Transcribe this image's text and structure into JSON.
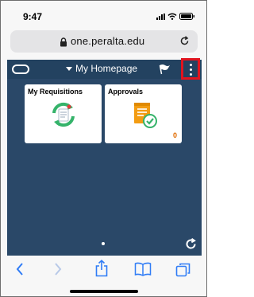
{
  "status_bar": {
    "time": "9:47",
    "icons": [
      "signal-icon",
      "wifi-icon",
      "battery-icon"
    ]
  },
  "browser": {
    "url": "one.peralta.edu",
    "icons": [
      "lock-icon",
      "reload-icon"
    ]
  },
  "app_header": {
    "title": "My Homepage",
    "icons": [
      "home-oval-icon",
      "caret-down-icon",
      "flag-icon",
      "actions-menu-icon"
    ],
    "highlight_color": "#e0141e"
  },
  "tiles": [
    {
      "title": "My Requisitions",
      "icon": "requisition-cycle-icon"
    },
    {
      "title": "Approvals",
      "icon": "approval-document-icon",
      "count": "0"
    }
  ],
  "page_indicator": "page-dot",
  "refresh_icon": "refresh-icon",
  "toolbar": {
    "items": [
      "back-icon",
      "forward-icon",
      "share-icon",
      "bookmarks-icon",
      "tabs-icon"
    ]
  },
  "colors": {
    "page_background": "#2a4868",
    "header_background": "#234260",
    "tile_count": "#e06b00",
    "ios_blue": "#2f7cf6"
  }
}
